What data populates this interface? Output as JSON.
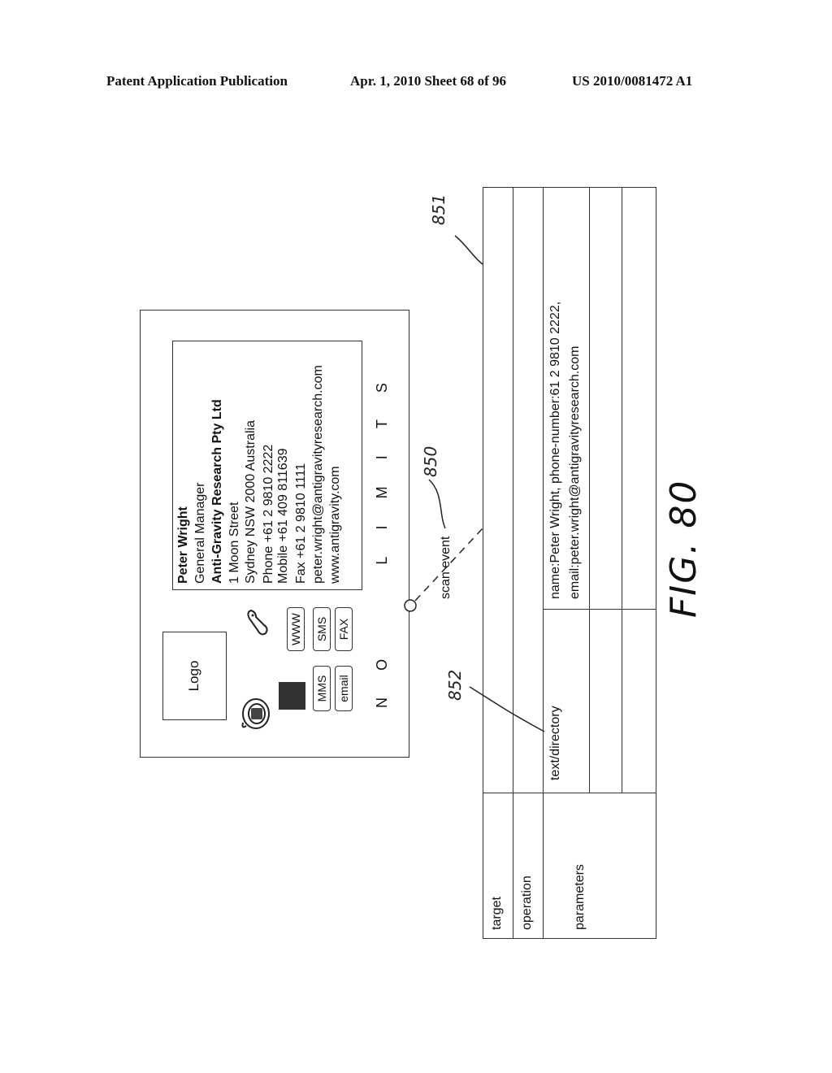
{
  "header": {
    "publication": "Patent Application Publication",
    "date_sheet": "Apr. 1, 2010   Sheet 68 of 96",
    "patent_number": "US 2010/0081472 A1"
  },
  "card": {
    "logo_label": "Logo",
    "lines": [
      {
        "text": "Peter Wright",
        "bold": true
      },
      {
        "text": "General Manager",
        "bold": false
      },
      {
        "text": "Anti-Gravity Research Pty Ltd",
        "bold": true
      },
      {
        "text": "1 Moon Street",
        "bold": false
      },
      {
        "text": "Sydney NSW 2000 Australia",
        "bold": false
      },
      {
        "text": "Phone +61 2 9810 2222",
        "bold": false
      },
      {
        "text": "Mobile +61 409 811639",
        "bold": false
      },
      {
        "text": "Fax +61 2 9810 1111",
        "bold": false
      },
      {
        "text": "peter.wright@antigravityresearch.com",
        "bold": false
      },
      {
        "text": "www.antigravity.com",
        "bold": false
      }
    ],
    "buttons": {
      "www": "WWW",
      "sms": "SMS",
      "fax": "FAX",
      "mms": "MMS",
      "email": "email"
    },
    "icons": [
      "desk-phone-icon",
      "mobile-phone-icon",
      "barcode-square-icon"
    ],
    "tagline_letters": [
      "N",
      "O",
      "L",
      "I",
      "M",
      "I",
      "T",
      "S"
    ]
  },
  "scan_event_label": "scan event",
  "table": {
    "rows": [
      {
        "label": "target",
        "value": ""
      },
      {
        "label": "operation",
        "value": ""
      },
      {
        "label": "parameters",
        "sub": [
          {
            "key": "text/directory",
            "value_lines": [
              "name:Peter Wright, phone-number:61 2 9810 2222,",
              "email:peter.wright@antigravityresearch.com"
            ]
          },
          {
            "key": "",
            "value_lines": []
          },
          {
            "key": "",
            "value_lines": []
          }
        ]
      }
    ]
  },
  "references": {
    "table": "851",
    "scan_event": "850",
    "text_directory": "852"
  },
  "figure_label": "FIG. 80"
}
